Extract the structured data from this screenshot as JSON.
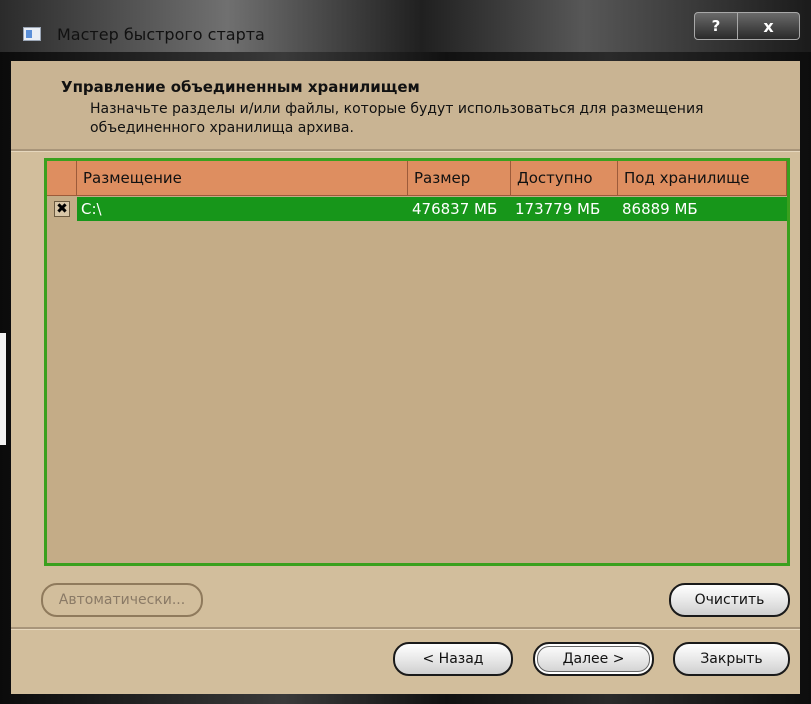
{
  "window": {
    "title": "Мастер быстрого старта",
    "help_button": "?",
    "close_button": "x",
    "app_icon": "wizard-app-icon"
  },
  "header": {
    "title": "Управление объединенным хранилищем",
    "description": "Назначьте разделы и/или файлы, которые будут использоваться для размещения объединенного хранилища архива."
  },
  "table": {
    "columns": [
      "Размещение",
      "Размер",
      "Доступно",
      "Под хранилище"
    ],
    "rows": [
      {
        "checked": "✖",
        "location": "C:\\",
        "size": "476837 МБ",
        "available": "173779 МБ",
        "storage": "86889 МБ"
      }
    ]
  },
  "buttons": {
    "auto": "Автоматически...",
    "clear": "Очистить",
    "back": "< Назад",
    "next": "Далее >",
    "close": "Закрыть"
  },
  "colors": {
    "accent_green": "#17961a",
    "header_orange": "#de8e60",
    "panel_tan": "#d2be9c"
  }
}
